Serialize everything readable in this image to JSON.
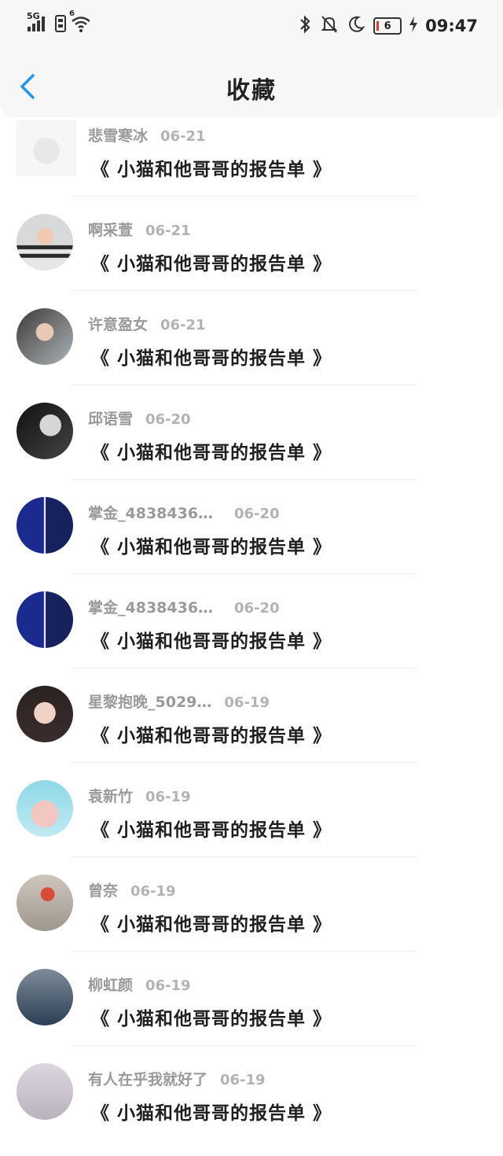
{
  "status_bar": {
    "network": "5G",
    "wifi_badge": "6",
    "battery_level": "6",
    "time": "09:47"
  },
  "header": {
    "title": "收藏"
  },
  "items": [
    {
      "name": "悲雪寒冰",
      "date": "06-21",
      "title": "《 小猫和他哥哥的报告单 》"
    },
    {
      "name": "啊采萱",
      "date": "06-21",
      "title": "《 小猫和他哥哥的报告单 》"
    },
    {
      "name": "许意盈女",
      "date": "06-21",
      "title": "《 小猫和他哥哥的报告单 》"
    },
    {
      "name": "邱语雪",
      "date": "06-20",
      "title": "《 小猫和他哥哥的报告单 》"
    },
    {
      "name": "掌金_48384360…",
      "date": "06-20",
      "title": "《 小猫和他哥哥的报告单 》"
    },
    {
      "name": "掌金_48384360…",
      "date": "06-20",
      "title": "《 小猫和他哥哥的报告单 》"
    },
    {
      "name": "星黎抱晚_5029…",
      "date": "06-19",
      "title": "《 小猫和他哥哥的报告单 》"
    },
    {
      "name": "袁新竹",
      "date": "06-19",
      "title": "《 小猫和他哥哥的报告单 》"
    },
    {
      "name": "曾奈",
      "date": "06-19",
      "title": "《 小猫和他哥哥的报告单 》"
    },
    {
      "name": "柳虹颜",
      "date": "06-19",
      "title": "《 小猫和他哥哥的报告单 》"
    },
    {
      "name": "有人在乎我就好了",
      "date": "06-19",
      "title": "《 小猫和他哥哥的报告单 》"
    }
  ],
  "colors": {
    "accent": "#2196f3",
    "background": "#ffffff",
    "header_bg": "#f7f7f7"
  }
}
